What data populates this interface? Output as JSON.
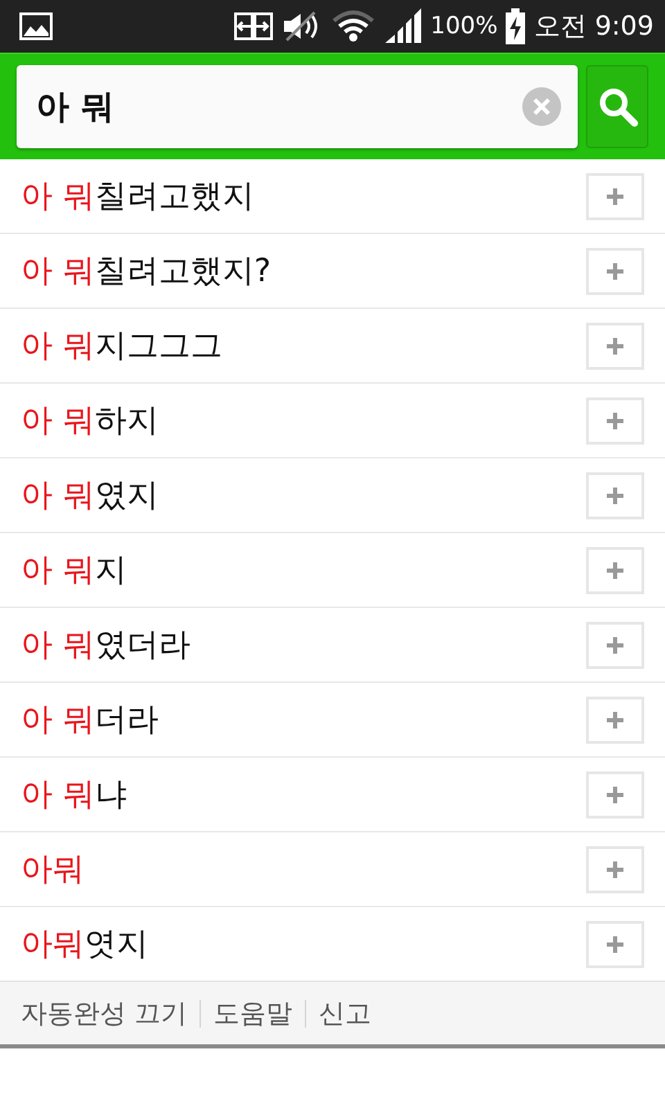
{
  "status_bar": {
    "battery": "100%",
    "time": "오전 9:09"
  },
  "search": {
    "value": "아 뭐"
  },
  "suggestions": [
    {
      "match": "아 뭐",
      "rest": "칠려고했지"
    },
    {
      "match": "아 뭐",
      "rest": "칠려고했지?"
    },
    {
      "match": "아 뭐",
      "rest": "지그그그"
    },
    {
      "match": "아 뭐",
      "rest": "하지"
    },
    {
      "match": "아 뭐",
      "rest": "였지"
    },
    {
      "match": "아 뭐",
      "rest": "지"
    },
    {
      "match": "아 뭐",
      "rest": "였더라"
    },
    {
      "match": "아 뭐",
      "rest": "더라"
    },
    {
      "match": "아 뭐",
      "rest": "냐"
    },
    {
      "match": "아뭐"
    },
    {
      "match": "아뭐",
      "rest": "엿지"
    }
  ],
  "footer_links": [
    "자동완성 끄기",
    "도움말",
    "신고"
  ]
}
